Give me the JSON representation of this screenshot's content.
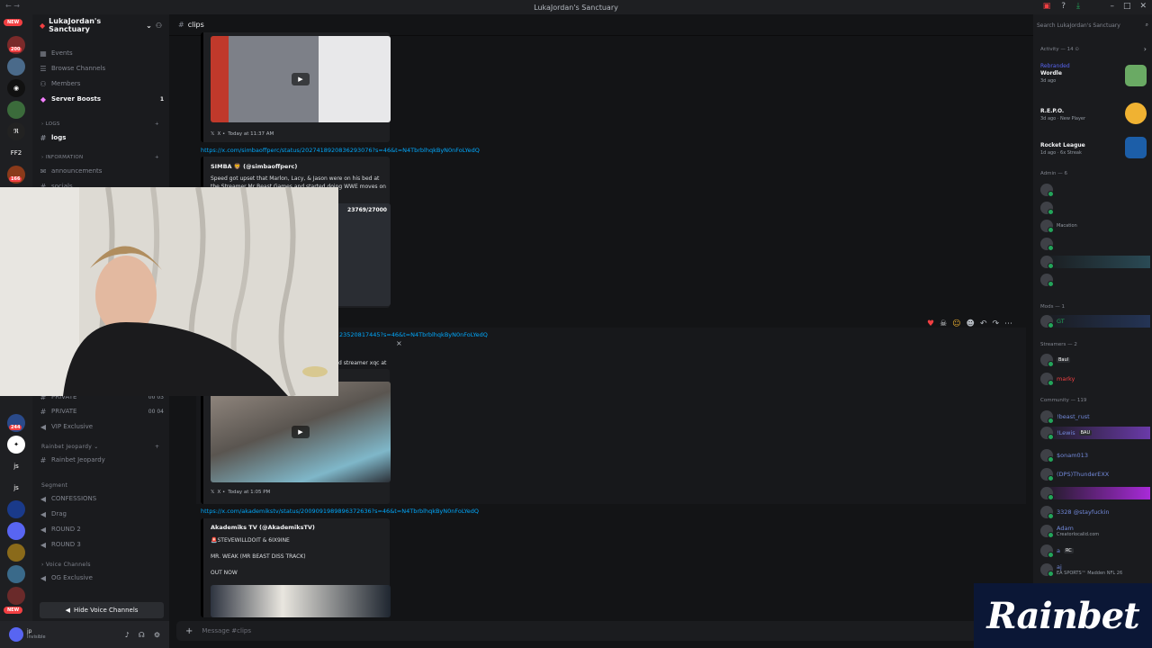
{
  "window": {
    "title": "LukaJordan's Sanctuary"
  },
  "server": {
    "name": "LukaJordan's Sanctuary",
    "rail_labels": {
      "new_top": "NEW",
      "ff2": "FF2",
      "js1": "js",
      "js2": "js",
      "new_bottom": "NEW"
    },
    "rail_badges": [
      "200",
      "244",
      "166"
    ]
  },
  "sidebar": {
    "items": [
      {
        "label": "Events"
      },
      {
        "label": "Browse Channels"
      },
      {
        "label": "Members"
      },
      {
        "label": "Server Boosts",
        "count": "1"
      }
    ],
    "categories": {
      "logs": "LOGS",
      "information": "INFORMATION",
      "rainbet_jeopardy": "Rainbet Jeopardy",
      "segment": "Segment",
      "voice": "Voice Channels"
    },
    "channels": {
      "logs": "logs",
      "announcements": "announcements",
      "socials": "socials",
      "private_top": "PRIVATE",
      "private": "PRIVATE",
      "private_a": "00",
      "private_b": "04",
      "private_top_a": "00",
      "private_top_b": "03",
      "vip": "VIP Exclusive",
      "jeopardy": "Rainbet Jeopardy",
      "confessions": "CONFESSIONS",
      "drag": "Drag",
      "round2": "ROUND 2",
      "round3": "ROUND 3",
      "og": "OG Exclusive"
    },
    "hide_voice": "Hide Voice Channels"
  },
  "user": {
    "name": "jp",
    "status": "Invisible"
  },
  "channel": {
    "name": "clips",
    "input_placeholder": "Message #clips"
  },
  "messages": [
    {
      "footer": "Today at 11:37 AM"
    },
    {
      "link": "https://x.com/simbaoffperc/status/2027418920836293076?s=46&t=N4TbrblhqkByN0nFoLYedQ",
      "author": "SIMBA 🦁 (@simbaoffperc)",
      "text": "Speed got upset that Marlon, Lacy, & Jason were on his bed at the Streamer Mr Beast Games and started doing WWE moves on them",
      "counter": "23769/27000"
    },
    {
      "link": "https://x.com/.../status/...2352081744 5?s=46&t=N4TbrblhqkByN0nFoLYedQ",
      "link_visible": "23520817445?s=46&t=N4TbrblhqkByN0nFoLYedQ",
      "text_visible": "d streamer xqc at",
      "footer": "Today at 1:05 PM"
    },
    {
      "link": "https://x.com/akademikstv/status/2009091989896372636?s=46&t=N4TbrblhqkByN0nFoLYedQ",
      "author": "Akademiks TV (@AkademiksTV)",
      "line1": "🚨STEVEWILLDOIT & 6IX9INE",
      "line2": "MR. WEAK (MR BEAST DISS TRACK)",
      "line3": "OUT NOW"
    }
  ],
  "members": {
    "search_placeholder": "Search LukaJordan's Sanctuary",
    "activity_header": "Activity — 14",
    "activities": [
      {
        "status": "Rebranded",
        "name": "Wordle",
        "sub": "3d ago"
      },
      {
        "name": "R.E.P.O.",
        "sub": "3d ago · New Player"
      },
      {
        "name": "Rocket League",
        "sub": "1d ago · 6x Streak"
      }
    ],
    "groups": {
      "admin": "Admin — 6",
      "mods": "Mods — 1",
      "streamers": "Streamers — 2",
      "community": "Community — 119"
    },
    "admin_visible": [
      "Macation"
    ],
    "mods": [
      "GT"
    ],
    "streamers": [
      "Baul",
      "marky"
    ],
    "community": [
      {
        "name": "!beast_rust"
      },
      {
        "name": "!Lewis",
        "tag": "BAU"
      },
      {
        "name": "$onam013"
      },
      {
        "name": "(DPS)ThunderEXX"
      },
      {
        "name": "3328 @stayfuckin"
      },
      {
        "name": "Adam",
        "sub": "Creatorlocalid.com"
      },
      {
        "name": "a",
        "tag": "RC"
      },
      {
        "name": "aj",
        "sub": "EA SPORTS™ Madden NFL 26"
      }
    ]
  },
  "brand": {
    "logo": "Rainbet"
  },
  "colors": {
    "accent": "#5865f2",
    "link": "#00a8fc",
    "danger": "#f23f42",
    "online": "#23a55a"
  }
}
